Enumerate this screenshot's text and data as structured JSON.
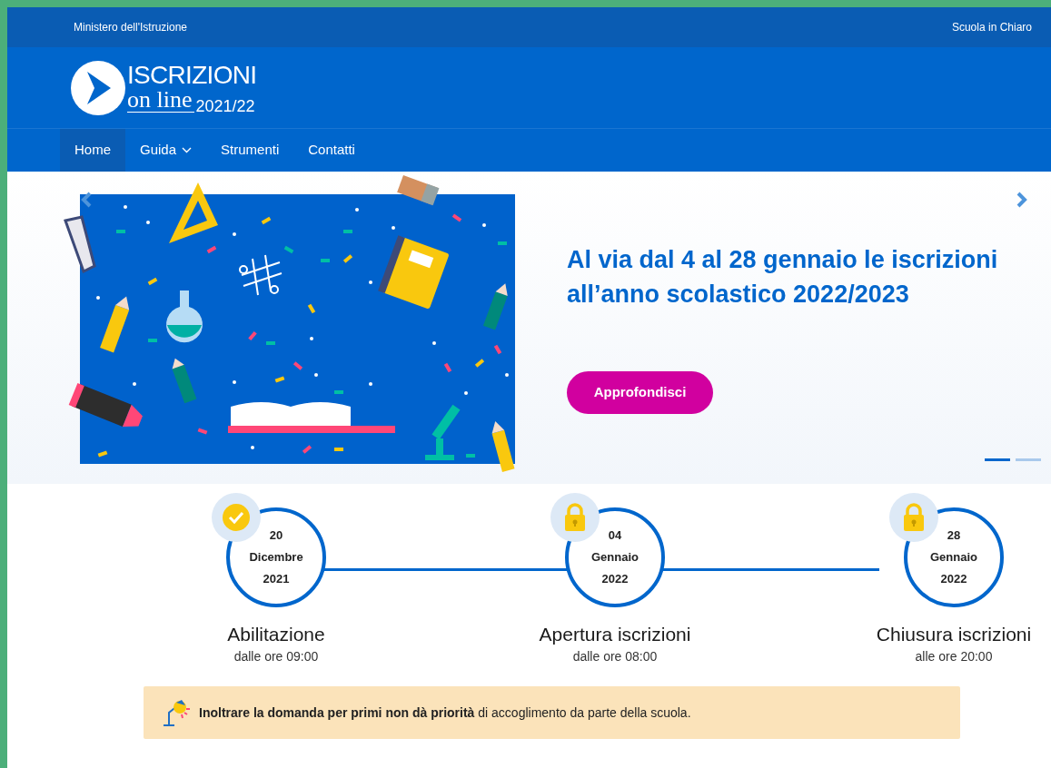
{
  "top_bar": {
    "left": "Ministero dell'Istruzione",
    "right": "Scuola in Chiaro"
  },
  "logo": {
    "title": "ISCRIZIONI",
    "subtitle": "on line",
    "year": "2021/22"
  },
  "nav": [
    {
      "label": "Home",
      "selected": true,
      "dropdown": false
    },
    {
      "label": "Guida",
      "selected": false,
      "dropdown": true
    },
    {
      "label": "Strumenti",
      "selected": false,
      "dropdown": false
    },
    {
      "label": "Contatti",
      "selected": false,
      "dropdown": false
    }
  ],
  "hero": {
    "title": "Al via dal 4 al 28 gennaio le iscrizioni all’anno scolastico 2022/2023",
    "button": "Approfondisci",
    "dots": [
      {
        "selected": true
      },
      {
        "selected": false
      }
    ]
  },
  "timeline": [
    {
      "kind": "done",
      "day": "20",
      "month": "Dicembre",
      "year": "2021",
      "title": "Abilitazione",
      "time": "dalle ore 09:00"
    },
    {
      "kind": "locked",
      "day": "04",
      "month": "Gennaio",
      "year": "2022",
      "title": "Apertura iscrizioni",
      "time": "dalle ore 08:00"
    },
    {
      "kind": "locked",
      "day": "28",
      "month": "Gennaio",
      "year": "2022",
      "title": "Chiusura iscrizioni",
      "time": "alle ore 20:00"
    }
  ],
  "notice": "**Inoltrare la domanda per primi non dà priorità** di accoglimento da parte della scuola."
}
